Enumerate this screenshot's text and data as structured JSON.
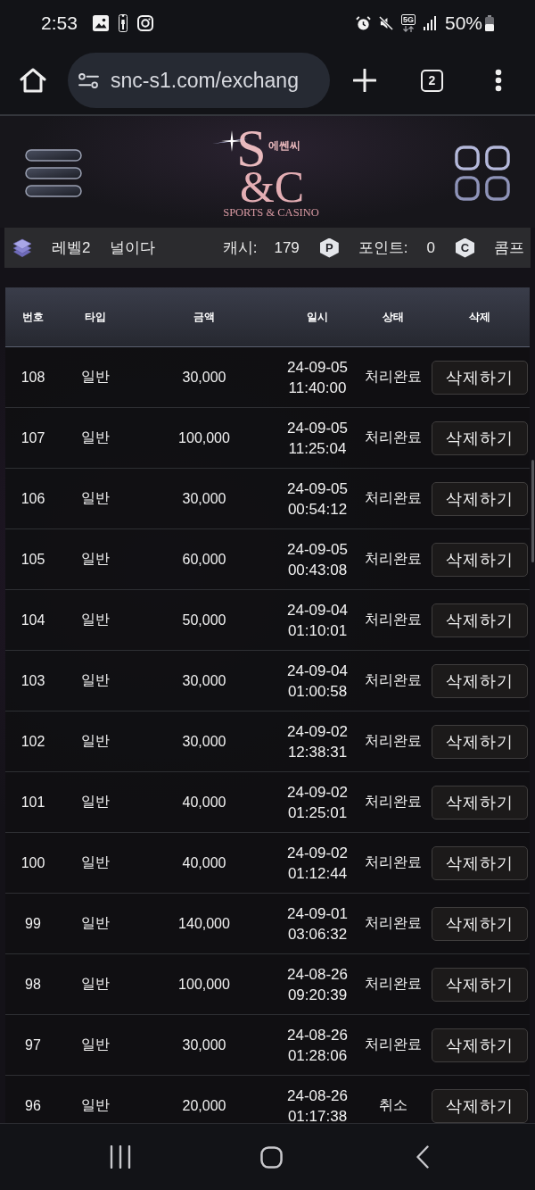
{
  "status_bar": {
    "time": "2:53",
    "network": "5G",
    "battery": "50%"
  },
  "browser": {
    "url": "snc-s1.com/exchang",
    "tab_count": "2"
  },
  "header": {
    "logo": {
      "monogram_top": "S",
      "korean": "에쎈씨",
      "monogram_bottom": "&C",
      "tagline": "SPORTS & CASINO"
    }
  },
  "user_bar": {
    "level": "레벨2",
    "username": "널이다",
    "cash_label": "캐시:",
    "cash": "179",
    "points_badge": "P",
    "points_label": "포인트:",
    "points": "0",
    "comp_badge": "C",
    "comp_label": "콤프"
  },
  "table": {
    "columns": [
      "번호",
      "타입",
      "금액",
      "일시",
      "상태",
      "삭제"
    ],
    "rows": [
      {
        "number": "108",
        "type": "일반",
        "amount": "30,000",
        "datetime": "24-09-05 11:40:00",
        "status": "처리완료",
        "action": "삭제하기"
      },
      {
        "number": "107",
        "type": "일반",
        "amount": "100,000",
        "datetime": "24-09-05 11:25:04",
        "status": "처리완료",
        "action": "삭제하기"
      },
      {
        "number": "106",
        "type": "일반",
        "amount": "30,000",
        "datetime": "24-09-05 00:54:12",
        "status": "처리완료",
        "action": "삭제하기"
      },
      {
        "number": "105",
        "type": "일반",
        "amount": "60,000",
        "datetime": "24-09-05 00:43:08",
        "status": "처리완료",
        "action": "삭제하기"
      },
      {
        "number": "104",
        "type": "일반",
        "amount": "50,000",
        "datetime": "24-09-04 01:10:01",
        "status": "처리완료",
        "action": "삭제하기"
      },
      {
        "number": "103",
        "type": "일반",
        "amount": "30,000",
        "datetime": "24-09-04 01:00:58",
        "status": "처리완료",
        "action": "삭제하기"
      },
      {
        "number": "102",
        "type": "일반",
        "amount": "30,000",
        "datetime": "24-09-02 12:38:31",
        "status": "처리완료",
        "action": "삭제하기"
      },
      {
        "number": "101",
        "type": "일반",
        "amount": "40,000",
        "datetime": "24-09-02 01:25:01",
        "status": "처리완료",
        "action": "삭제하기"
      },
      {
        "number": "100",
        "type": "일반",
        "amount": "40,000",
        "datetime": "24-09-02 01:12:44",
        "status": "처리완료",
        "action": "삭제하기"
      },
      {
        "number": "99",
        "type": "일반",
        "amount": "140,000",
        "datetime": "24-09-01 03:06:32",
        "status": "처리완료",
        "action": "삭제하기"
      },
      {
        "number": "98",
        "type": "일반",
        "amount": "100,000",
        "datetime": "24-08-26 09:20:39",
        "status": "처리완료",
        "action": "삭제하기"
      },
      {
        "number": "97",
        "type": "일반",
        "amount": "30,000",
        "datetime": "24-08-26 01:28:06",
        "status": "처리완료",
        "action": "삭제하기"
      },
      {
        "number": "96",
        "type": "일반",
        "amount": "20,000",
        "datetime": "24-08-26 01:17:38",
        "status": "취소",
        "action": "삭제하기"
      }
    ]
  }
}
